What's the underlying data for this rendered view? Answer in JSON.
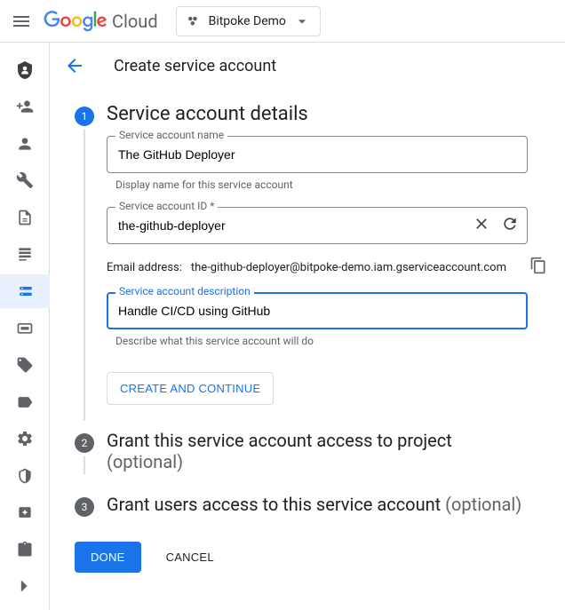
{
  "topbar": {
    "logo_text": "Cloud",
    "project_name": "Bitpoke Demo"
  },
  "header": {
    "title": "Create service account"
  },
  "step1": {
    "number": "1",
    "title": "Service account details",
    "name_label": "Service account name",
    "name_value": "The GitHub Deployer",
    "name_helper": "Display name for this service account",
    "id_label": "Service account ID *",
    "id_value": "the-github-deployer",
    "email_label": "Email address:",
    "email_value": "the-github-deployer@bitpoke-demo.iam.gserviceaccount.com",
    "desc_label": "Service account description",
    "desc_value": "Handle CI/CD using GitHub",
    "desc_helper": "Describe what this service account will do",
    "continue_btn": "CREATE AND CONTINUE"
  },
  "step2": {
    "number": "2",
    "title": "Grant this service account access to project ",
    "optional": "(optional)"
  },
  "step3": {
    "number": "3",
    "title": "Grant users access to this service account ",
    "optional": "(optional)"
  },
  "footer": {
    "done": "DONE",
    "cancel": "CANCEL"
  }
}
